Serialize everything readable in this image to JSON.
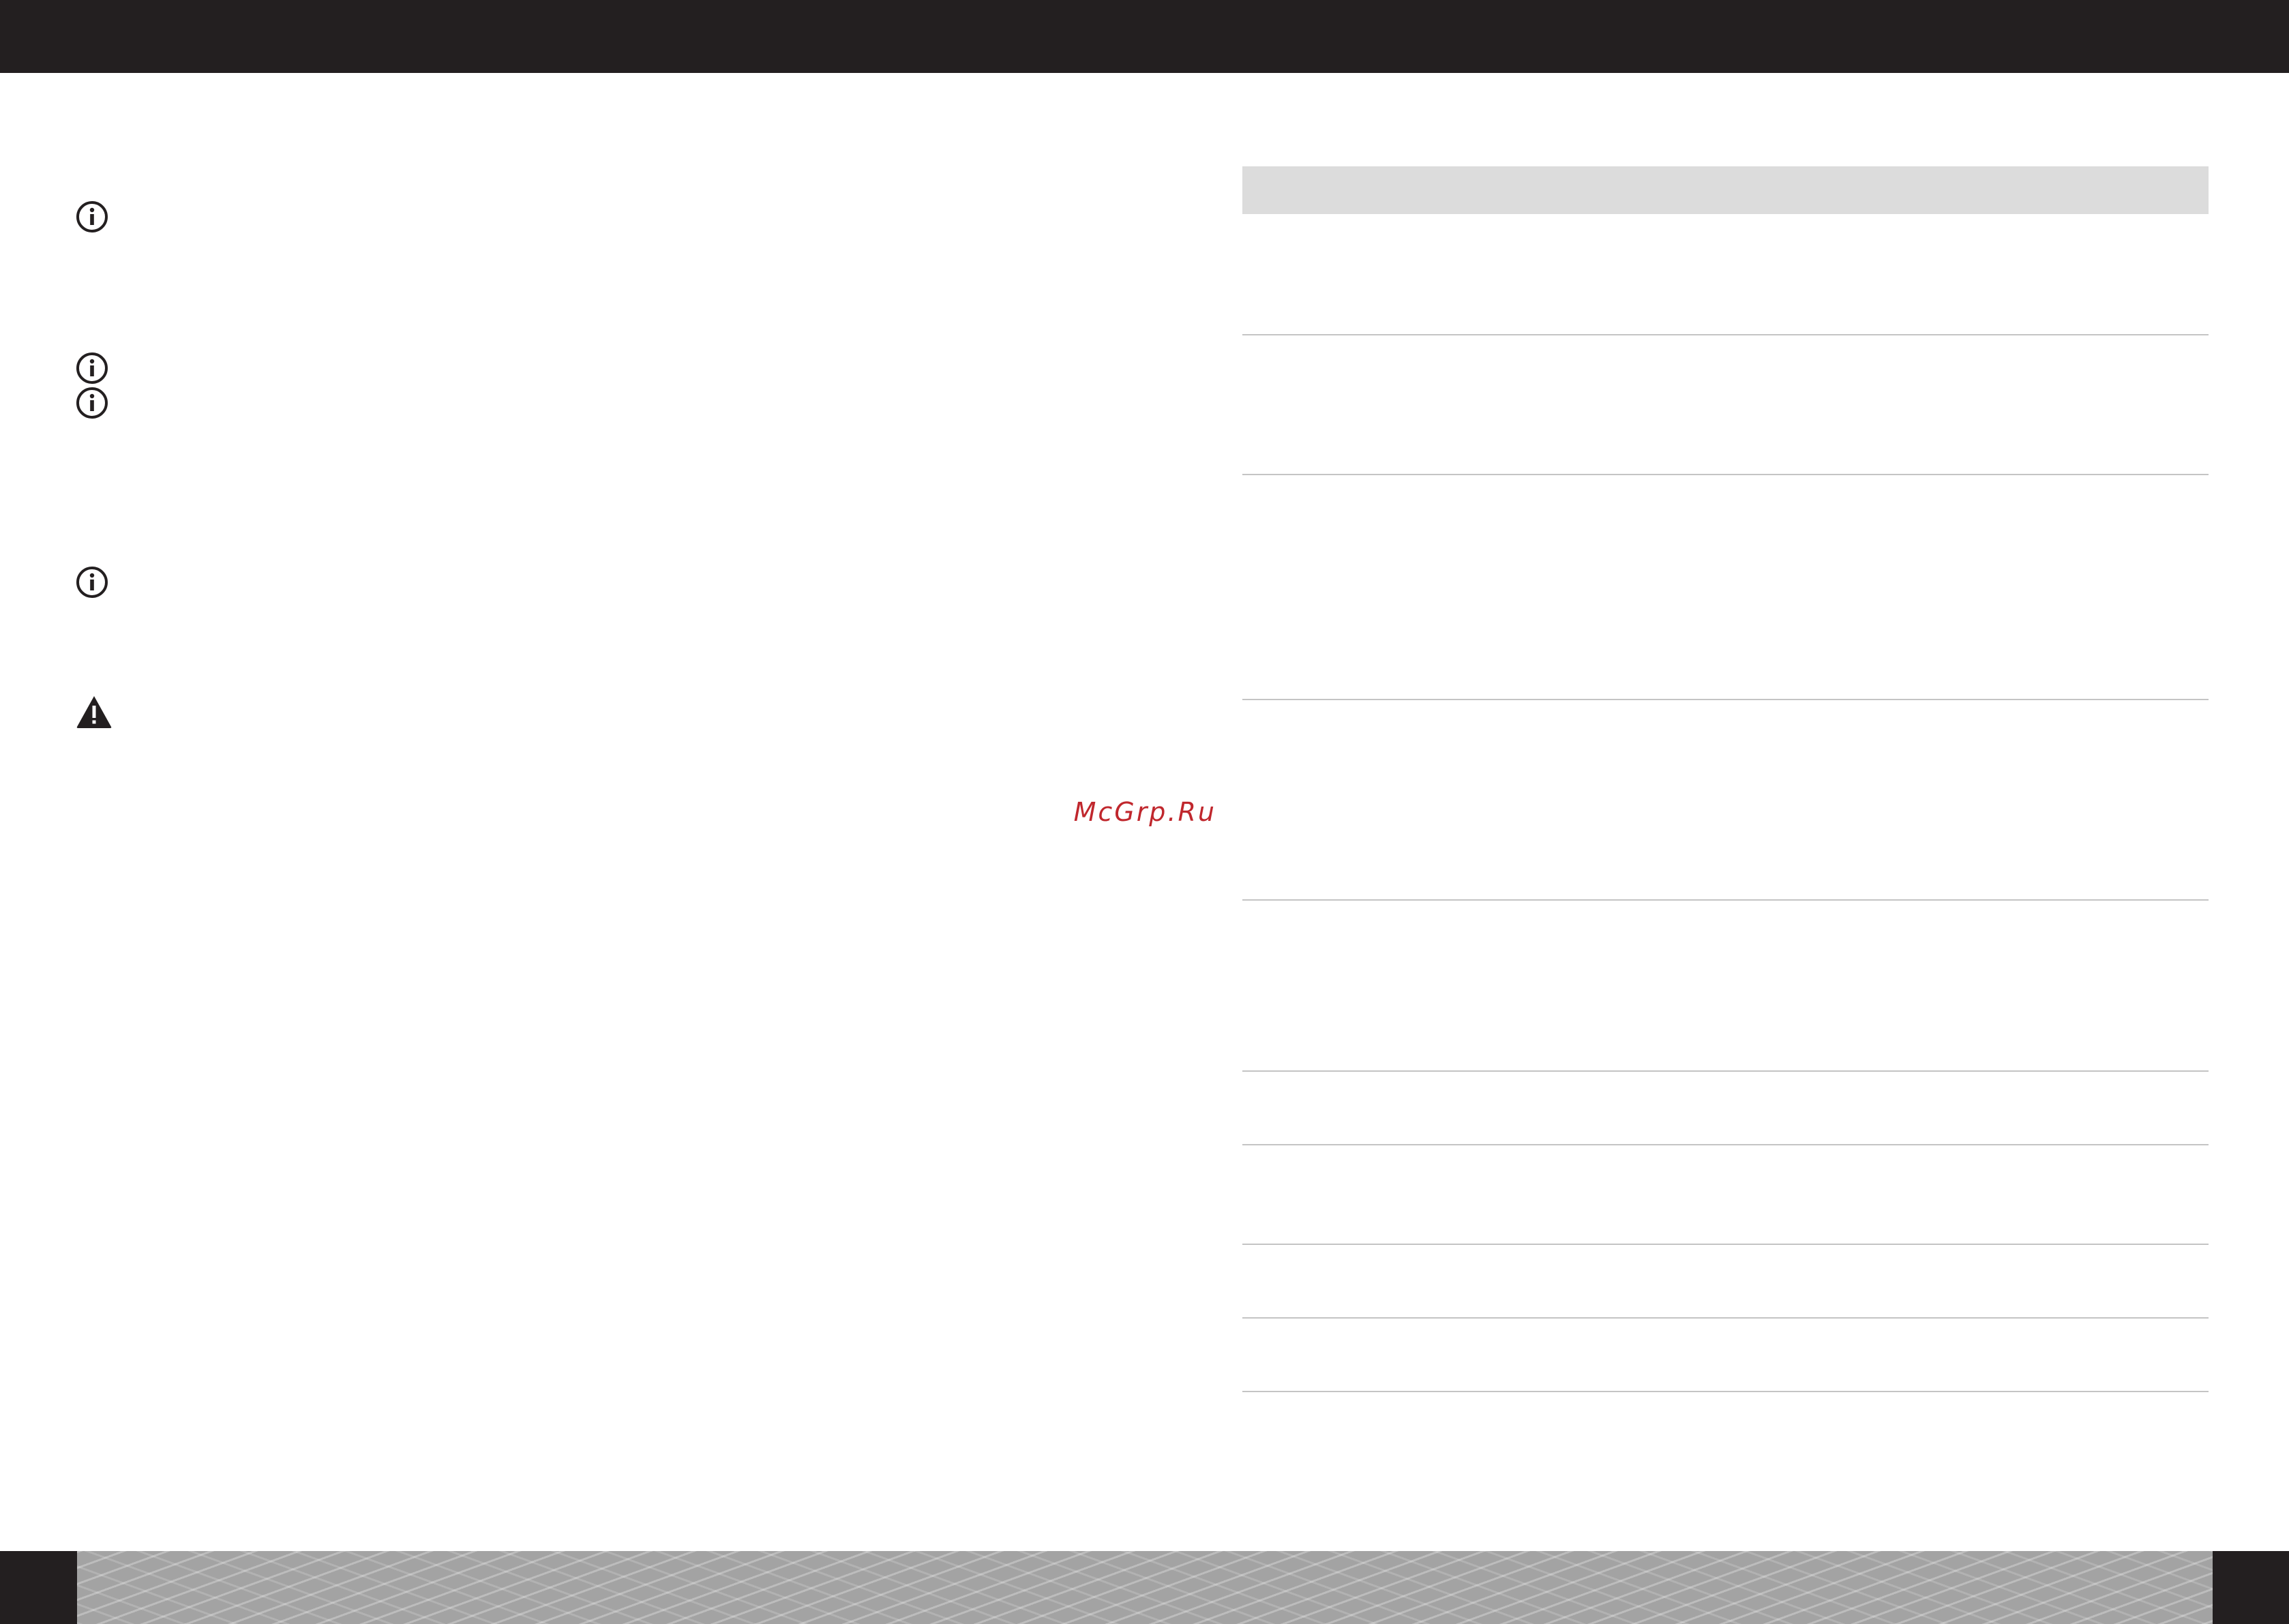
{
  "watermark": {
    "text": "McGrp.Ru"
  },
  "icons": [
    "info-icon",
    "info-icon",
    "info-icon",
    "info-icon",
    "warning-icon"
  ],
  "spec_table": {
    "row_count": 9
  },
  "colors": {
    "top_bar": "#231f20",
    "table_header": "#dcdcdc",
    "table_rule": "#c4c4c4",
    "watermark": "#c0272d",
    "footer_pattern": "#a3a3a3"
  }
}
